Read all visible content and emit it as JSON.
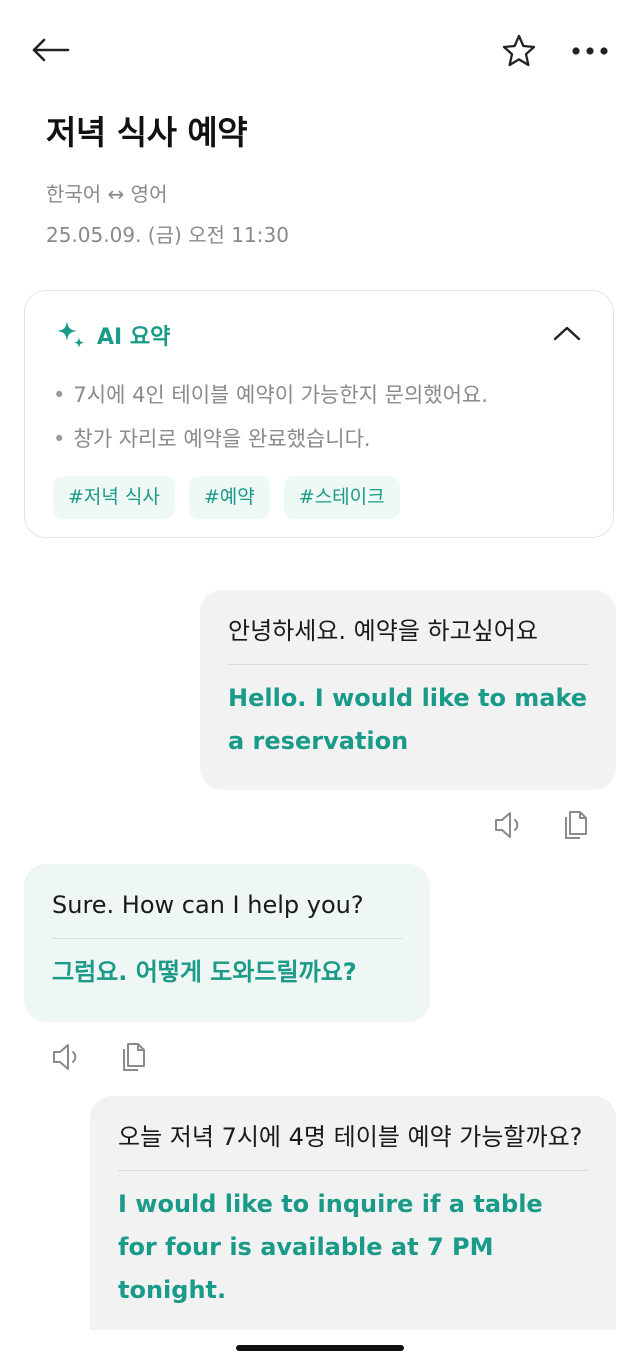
{
  "header": {
    "title": "저녁 식사 예약",
    "language_pair": "한국어 ↔ 영어",
    "timestamp": "25.05.09. (금) 오전 11:30"
  },
  "icons": {
    "back": "arrow-left-icon",
    "favorite": "star-outline-icon",
    "more": "more-horizontal-icon",
    "summary": "sparkle-icon",
    "collapse": "chevron-up-icon",
    "speak": "speaker-icon",
    "copy": "copy-icon"
  },
  "summary": {
    "title": "AI 요약",
    "bullets": [
      "7시에 4인 테이블 예약이 가능한지 문의했어요.",
      "창가 자리로 예약을 완료했습니다."
    ],
    "tags": [
      "#저녁 식사",
      "#예약",
      "#스테이크"
    ]
  },
  "messages": [
    {
      "side": "sent",
      "original": "안녕하세요. 예약을 하고싶어요",
      "translation": "Hello. I would like to make a reservation"
    },
    {
      "side": "received",
      "original": "Sure. How can I help you?",
      "translation": "그럼요. 어떻게 도와드릴까요?"
    },
    {
      "side": "sent",
      "original": "오늘 저녁 7시에 4명 테이블 예약 가능할까요?",
      "translation": "I would like to inquire if a table for four is available at 7 PM tonight."
    }
  ],
  "colors": {
    "accent": "#1a9a88",
    "sent_bubble": "#f2f2f2",
    "received_bubble": "#eef7f3",
    "tag_bg": "#eef8f5",
    "muted_text": "#8a8a8a"
  }
}
